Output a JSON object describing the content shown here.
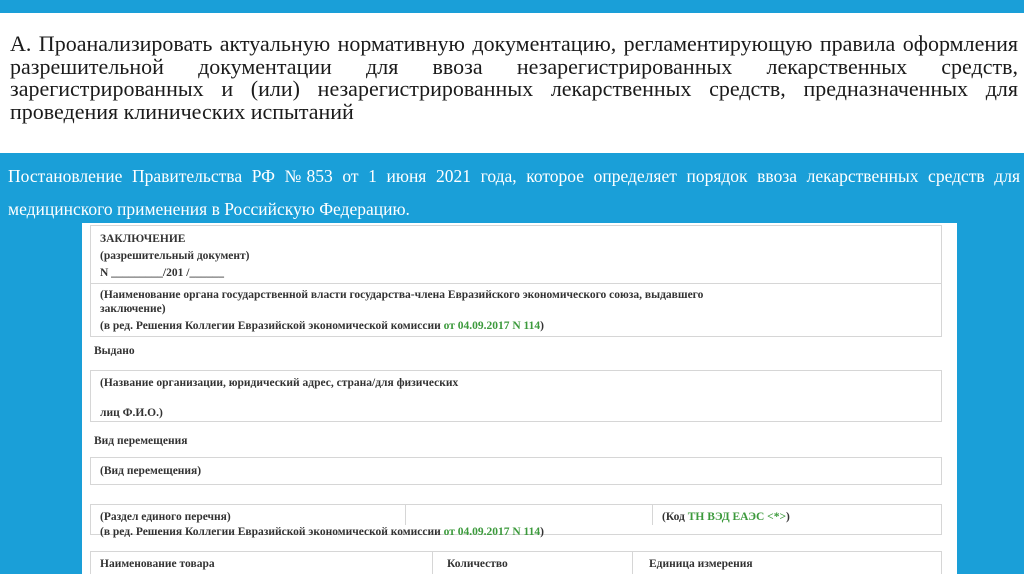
{
  "slide": {
    "title": "А. Проанализировать актуальную нормативную документацию, регламентирующую правила оформления разрешительной документации для ввоза незарегистрированных лекарственных средств, зарегистрированных и (или) незарегистрированных лекарственных средств, предназначенных для проведения клинических испытаний",
    "subtitle": "Постановление Правительства РФ №853 от 1 июня 2021 года, которое определяет порядок ввоза лекарственных средств для медицинского применения в Российскую Федерацию.",
    "colors": {
      "accent": "#1a9fd8",
      "link_green": "#3c9a3c"
    }
  },
  "document": {
    "heading": "ЗАКЛЮЧЕНИЕ",
    "doc_type": "(разрешительный документ)",
    "number_line": "N _________/201 /______",
    "issuer_note_1": "(Наименование органа государственной власти государства-члена Евразийского экономического союза, выдавшего",
    "issuer_note_2": "заключение)",
    "edition_prefix": "(в ред. Решения Коллегии Евразийской экономической комиссии ",
    "edition_link": "от 04.09.2017 N 114",
    "edition_suffix": ")",
    "issued_to_label": "Выдано",
    "org_note_1": "(Название организации, юридический адрес, страна/для физических",
    "org_note_2": "лиц Ф.И.О.)",
    "movement_label": "Вид перемещения",
    "movement_note": "(Вид перемещения)",
    "section_note": "(Раздел единого перечня)",
    "code_prefix": "(Код ",
    "code_link": "ТН ВЭД ЕАЭС <*>",
    "code_suffix": ")",
    "edition2_prefix": "(в ред. Решения Коллегии Евразийской экономической комиссии ",
    "edition2_link": "от 04.09.2017 N 114",
    "edition2_suffix": ")",
    "table_headers": [
      "Наименование товара",
      "Количество",
      "Единица измерения"
    ]
  }
}
